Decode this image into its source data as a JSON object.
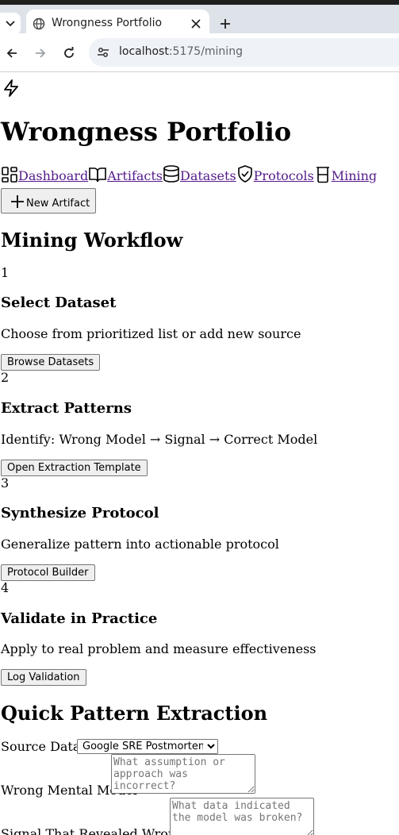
{
  "browser": {
    "tab_title": "Wrongness Portfolio",
    "url_host": "localhost",
    "url_path": ":5175/mining"
  },
  "app": {
    "title": "Wrongness Portfolio",
    "nav": [
      {
        "label": "Dashboard",
        "icon": "dashboard-icon"
      },
      {
        "label": "Artifacts",
        "icon": "book-icon"
      },
      {
        "label": "Datasets",
        "icon": "database-icon"
      },
      {
        "label": "Protocols",
        "icon": "shield-icon"
      },
      {
        "label": "Mining",
        "icon": "beaker-icon"
      }
    ],
    "new_artifact_label": "New Artifact"
  },
  "workflow": {
    "title": "Mining Workflow",
    "steps": [
      {
        "number": "1",
        "title": "Select Dataset",
        "description": "Choose from prioritized list or add new source",
        "button": "Browse Datasets"
      },
      {
        "number": "2",
        "title": "Extract Patterns",
        "description": "Identify: Wrong Model → Signal → Correct Model",
        "button": "Open Extraction Template"
      },
      {
        "number": "3",
        "title": "Synthesize Protocol",
        "description": "Generalize pattern into actionable protocol",
        "button": "Protocol Builder"
      },
      {
        "number": "4",
        "title": "Validate in Practice",
        "description": "Apply to real problem and measure effectiveness",
        "button": "Log Validation"
      }
    ]
  },
  "extraction": {
    "title": "Quick Pattern Extraction",
    "source_label": "Source Dataset",
    "source_value": "Google SRE Postmortems",
    "wrong_model_label": "Wrong Mental Model",
    "wrong_model_placeholder": "What assumption or approach was incorrect?",
    "signal_label": "Signal That Revealed Wrongness",
    "signal_placeholder": "What data indicated the model was broken?"
  }
}
